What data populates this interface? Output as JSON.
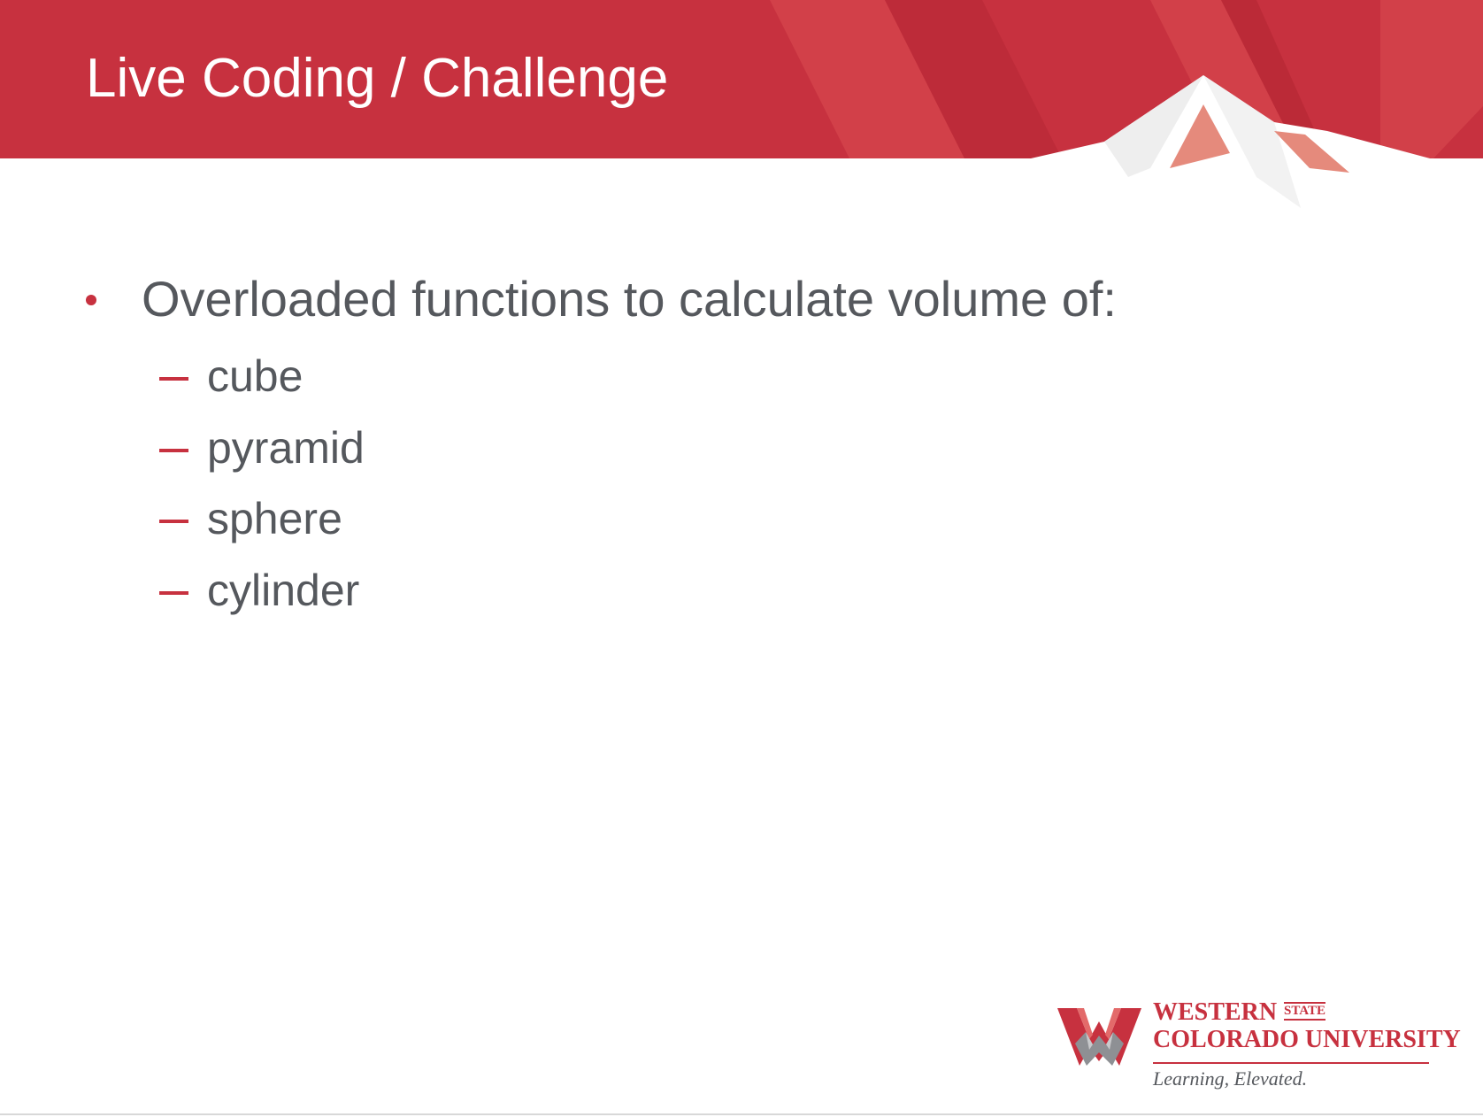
{
  "slide": {
    "title": "Live Coding / Challenge",
    "bullet": "Overloaded functions to calculate volume of:",
    "sub_items": [
      {
        "text": "cube"
      },
      {
        "text": "pyramid"
      },
      {
        "text": "sphere"
      },
      {
        "text": "cylinder"
      }
    ]
  },
  "logo": {
    "line1": "WESTERN",
    "state": "STATE",
    "line2": "COLORADO UNIVERSITY",
    "tagline": "Learning, Elevated."
  },
  "colors": {
    "header_red": "#c7313f",
    "text_gray": "#55585d"
  }
}
